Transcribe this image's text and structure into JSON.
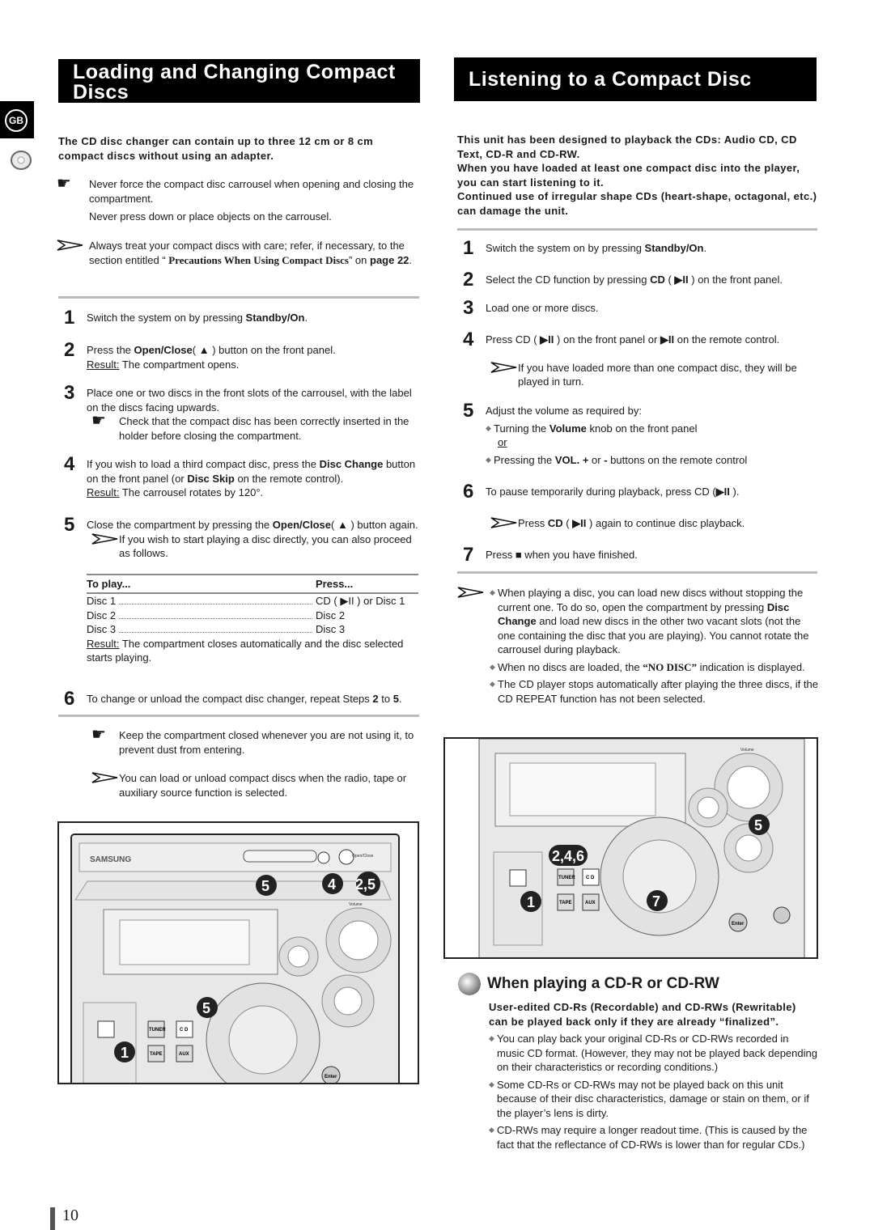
{
  "side_tab": {
    "label": "GB",
    "icon": "disc-icon"
  },
  "left": {
    "title": "Loading and Changing Compact Discs",
    "intro": "The CD disc changer can contain up to three 12 cm or 8 cm compact discs without using an adapter.",
    "note1": "Never force the compact disc carrousel when opening and closing the compartment.",
    "note1b": "Never press down or place objects on the carrousel.",
    "note2": [
      [
        "Always treat your compact discs with care; refer, if necessary, to the section entitled “ ",
        ""
      ],
      [
        "Precautions When Using Compact Discs",
        "s"
      ],
      [
        "” on ",
        ""
      ],
      [
        "page 22",
        "b"
      ],
      [
        ".",
        ""
      ]
    ],
    "steps": [
      {
        "n": "1",
        "lines": [
          [
            [
              "Switch the system on by pressing ",
              ""
            ],
            [
              "Standby/On",
              "b"
            ],
            [
              ".",
              ""
            ]
          ]
        ]
      },
      {
        "n": "2",
        "lines": [
          [
            [
              "Press the ",
              ""
            ],
            [
              "Open/Close",
              "b"
            ],
            [
              "( ▲ ) button on the front panel.",
              ""
            ]
          ],
          [
            [
              "Result:",
              "u"
            ],
            [
              " The compartment opens.",
              ""
            ]
          ]
        ]
      },
      {
        "n": "3",
        "lines": [
          [
            [
              "Place one or two discs in the front slots of the carrousel, with the label on the discs facing upwards.",
              ""
            ]
          ]
        ],
        "note": "Check that the compact disc has been correctly inserted in the holder before closing the compartment."
      },
      {
        "n": "4",
        "lines": [
          [
            [
              "If you wish to load a third compact disc, press the ",
              ""
            ],
            [
              "Disc Change",
              "b"
            ],
            [
              " button on the front panel (or ",
              ""
            ],
            [
              "Disc Skip",
              "b"
            ],
            [
              " on the remote control).",
              ""
            ]
          ],
          [
            [
              "Result:",
              "u"
            ],
            [
              " The carrousel rotates by 120°.",
              ""
            ]
          ]
        ]
      },
      {
        "n": "5",
        "lines": [
          [
            [
              "Close the compartment by pressing the ",
              ""
            ],
            [
              "Open/Close",
              "b"
            ],
            [
              "( ▲ ) button again.",
              ""
            ]
          ]
        ],
        "note": "If you wish to start playing a disc directly, you can also proceed as follows."
      },
      {
        "n": "6",
        "lines": [
          [
            [
              "To change or unload the compact disc changer, repeat Steps ",
              ""
            ],
            [
              "2",
              "b"
            ],
            [
              " to ",
              ""
            ],
            [
              "5",
              "b"
            ],
            [
              ".",
              ""
            ]
          ]
        ]
      }
    ],
    "table": {
      "headers": [
        "To play...",
        "Press..."
      ],
      "rows": [
        [
          "Disc 1",
          "CD ( ▶II ) or Disc 1"
        ],
        [
          "Disc 2",
          "Disc 2"
        ],
        [
          "Disc 3",
          "Disc 3"
        ]
      ],
      "result": [
        [
          "Result:",
          "u"
        ],
        [
          " The compartment closes automatically and the disc selected starts playing.",
          ""
        ]
      ]
    },
    "note3": "Keep the compartment closed whenever you are not using it, to prevent dust from entering.",
    "note4": "You can load or unload compact discs when the radio, tape or auxiliary source function is selected.",
    "figure": {
      "brand": "SAMSUNG",
      "callouts": [
        "5",
        "4",
        "2,5",
        "5",
        "1"
      ],
      "labels": [
        "TUNER",
        "C D",
        "TAPE",
        "AUX",
        "Enter",
        "Open/Close",
        "Volume"
      ]
    }
  },
  "right": {
    "title": "Listening to a Compact Disc",
    "intro": [
      "This unit has been designed to playback the CDs: Audio CD, CD Text, CD-R and CD-RW.",
      "When you have loaded at least one compact disc into the player, you can start listening to it.",
      "Continued use of irregular shape CDs (heart-shape, octagonal, etc.) can damage the unit."
    ],
    "steps": [
      {
        "n": "1",
        "lines": [
          [
            [
              "Switch the system on by pressing ",
              ""
            ],
            [
              "Standby/On",
              "b"
            ],
            [
              ".",
              ""
            ]
          ]
        ]
      },
      {
        "n": "2",
        "lines": [
          [
            [
              "Select the CD function by pressing ",
              ""
            ],
            [
              "CD",
              "b"
            ],
            [
              " ( ",
              ""
            ],
            [
              "▶II",
              "b"
            ],
            [
              " ) on the front panel.",
              ""
            ]
          ]
        ]
      },
      {
        "n": "3",
        "lines": [
          [
            [
              "Load one or more discs.",
              ""
            ]
          ]
        ]
      },
      {
        "n": "4",
        "lines": [
          [
            [
              "Press CD ( ",
              ""
            ],
            [
              "▶II",
              "b"
            ],
            [
              " ) on the front panel or ",
              ""
            ],
            [
              "▶II",
              "b"
            ],
            [
              "  on the remote control.",
              ""
            ]
          ]
        ],
        "note": "If you have loaded more than one compact disc, they will be played in turn."
      },
      {
        "n": "5",
        "lines": [
          [
            [
              "Adjust the volume as required by:",
              ""
            ]
          ]
        ],
        "bullets": [
          [
            [
              "Turning the ",
              ""
            ],
            [
              "Volume",
              "b"
            ],
            [
              " knob on the front panel",
              ""
            ]
          ],
          [
            [
              "Pressing the ",
              ""
            ],
            [
              "VOL. +",
              "b"
            ],
            [
              " or ",
              ""
            ],
            [
              "-",
              "b"
            ],
            [
              " buttons on the remote control",
              ""
            ]
          ]
        ],
        "or": "or"
      },
      {
        "n": "6",
        "lines": [
          [
            [
              "To pause temporarily during playback, press CD (",
              ""
            ],
            [
              "▶II",
              "b"
            ],
            [
              " ).",
              ""
            ]
          ]
        ],
        "note_rich": [
          [
            "Press ",
            ""
          ],
          [
            "CD",
            "b"
          ],
          [
            " ( ",
            ""
          ],
          [
            "▶II",
            "b"
          ],
          [
            " ) again to continue disc playback.",
            ""
          ]
        ]
      },
      {
        "n": "7",
        "lines": [
          [
            [
              "Press  ■  when you have finished.",
              ""
            ]
          ]
        ]
      }
    ],
    "notes": [
      [
        [
          "When playing a disc, you can load new discs without stopping the current one. To do so, open the compartment by pressing ",
          ""
        ],
        [
          "Disc Change",
          "b"
        ],
        [
          " and load new discs in the other two vacant slots (not the one containing the disc that you are playing). You cannot rotate the carrousel during playback.",
          ""
        ]
      ],
      [
        [
          "When no discs are loaded, the ",
          ""
        ],
        [
          "“NO DISC”",
          "s"
        ],
        [
          " indication is displayed.",
          ""
        ]
      ],
      [
        [
          "The CD player stops automatically after playing the three discs, if the CD REPEAT function has not been selected.",
          ""
        ]
      ]
    ],
    "figure": {
      "callouts": [
        "5",
        "2,4,6",
        "1",
        "7"
      ],
      "labels": [
        "TUNER",
        "C D",
        "TAPE",
        "AUX",
        "Enter",
        "Volume"
      ]
    },
    "cdr": {
      "heading": "When playing a CD-R or CD-RW",
      "intro": "User-edited CD-Rs (Recordable) and CD-RWs (Rewritable) can be played back only if they are already “finalized”.",
      "bullets": [
        "You can play back your original CD-Rs or CD-RWs recorded in music CD format. (However, they may not be played back depending on their characteristics or recording conditions.)",
        "Some CD-Rs or CD-RWs may not be played back on this unit because of their disc characteristics, damage or stain on them, or if the player’s lens is dirty.",
        "CD-RWs may require a longer readout time. (This is caused by the fact that the reflectance of CD-RWs is lower than for regular CDs.)"
      ]
    }
  },
  "page_number": "10"
}
